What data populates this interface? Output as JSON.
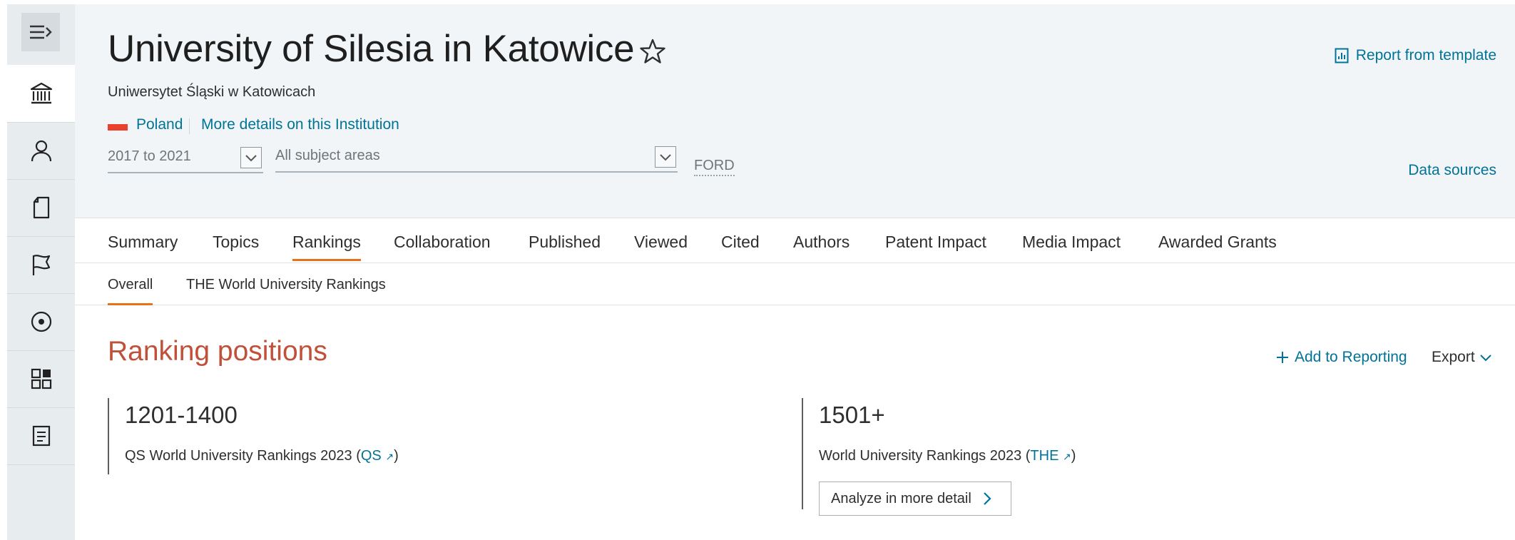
{
  "rail": {
    "items": [
      {
        "icon": "institution-icon",
        "active": true
      },
      {
        "icon": "person-icon",
        "active": false
      },
      {
        "icon": "journal-icon",
        "active": false
      },
      {
        "icon": "flag-icon",
        "active": false
      },
      {
        "icon": "target-icon",
        "active": false
      },
      {
        "icon": "dashboard-icon",
        "active": false
      },
      {
        "icon": "report-icon",
        "active": false
      }
    ]
  },
  "header": {
    "title": "University of Silesia in Katowice",
    "subtitle": "Uniwersytet Śląski w Katowicach",
    "country": "Poland",
    "more_details": "More details on this Institution",
    "report_link": "Report from template",
    "year_range": "2017 to 2021",
    "subject_areas": "All subject areas",
    "ford": "FORD",
    "data_sources": "Data sources"
  },
  "tabs": [
    "Summary",
    "Topics",
    "Rankings",
    "Collaboration",
    "Published",
    "Viewed",
    "Cited",
    "Authors",
    "Patent Impact",
    "Media Impact",
    "Awarded Grants"
  ],
  "active_tab": "Rankings",
  "subtabs": [
    "Overall",
    "THE World University Rankings"
  ],
  "active_subtab": "Overall",
  "section": {
    "title": "Ranking positions",
    "add_to_reporting": "Add to Reporting",
    "export": "Export"
  },
  "rankings": [
    {
      "position": "1201-1400",
      "source_prefix": "QS World University Rankings 2023 (",
      "link": "QS",
      "source_suffix": ")"
    },
    {
      "position": "1501+",
      "source_prefix": "World University Rankings 2023 (",
      "link": "THE",
      "source_suffix": ")",
      "button": "Analyze in more detail"
    }
  ],
  "colors": {
    "accent_link": "#007398",
    "section_title": "#c0503a",
    "tab_underline": "#e9711c",
    "flag_red": "#e9412c"
  }
}
